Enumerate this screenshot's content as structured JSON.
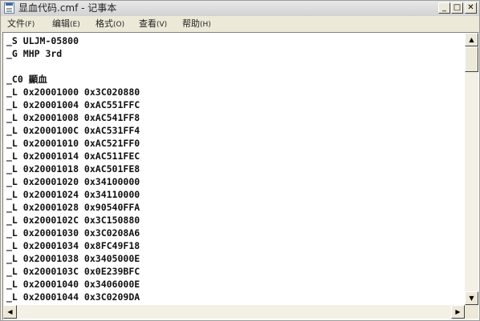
{
  "window": {
    "title": "显血代码.cmf - 记事本",
    "controls": {
      "minimize": "_",
      "maximize": "□",
      "close": "✕"
    }
  },
  "menu": {
    "file": {
      "label": "文件",
      "key": "(F)"
    },
    "edit": {
      "label": "编辑",
      "key": "(E)"
    },
    "format": {
      "label": "格式",
      "key": "(O)"
    },
    "view": {
      "label": "查看",
      "key": "(V)"
    },
    "help": {
      "label": "帮助",
      "key": "(H)"
    }
  },
  "document": {
    "lines": [
      "_S ULJM-05800",
      "_G MHP 3rd",
      "",
      "_C0 顯血",
      "_L 0x20001000 0x3C020880",
      "_L 0x20001004 0xAC551FFC",
      "_L 0x20001008 0xAC541FF8",
      "_L 0x2000100C 0xAC531FF4",
      "_L 0x20001010 0xAC521FF0",
      "_L 0x20001014 0xAC511FEC",
      "_L 0x20001018 0xAC501FE8",
      "_L 0x20001020 0x34100000",
      "_L 0x20001024 0x34110000",
      "_L 0x20001028 0x90540FFA",
      "_L 0x2000102C 0x3C150880",
      "_L 0x20001030 0x3C0208A6",
      "_L 0x20001034 0x8FC49F18",
      "_L 0x20001038 0x3405000E",
      "_L 0x2000103C 0x0E239BFC",
      "_L 0x20001040 0x3406000E",
      "_L 0x20001044 0x3C0209DA"
    ]
  },
  "scrollbars": {
    "up_arrow": "▲",
    "down_arrow": "▼",
    "left_arrow": "◀",
    "right_arrow": "▶"
  }
}
